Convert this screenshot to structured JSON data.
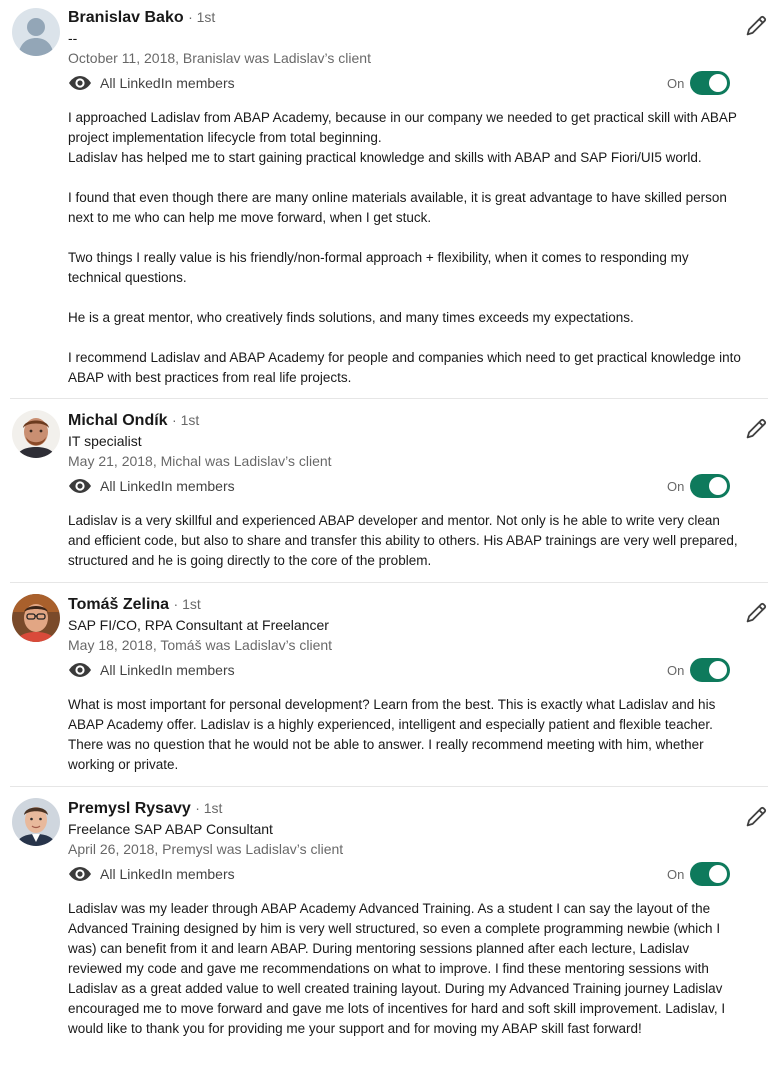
{
  "recommendations": [
    {
      "name": "Branislav Bako",
      "degree": "· 1st",
      "headline": "--",
      "date": "October 11, 2018, Branislav was Ladislav’s client",
      "visibility": "All LinkedIn members",
      "toggle_label": "On",
      "avatar": "default-person-avatar",
      "paragraphs": [
        "I approached Ladislav from ABAP Academy, because in our company we needed to get practical skill with ABAP project implementation lifecycle from total beginning.",
        "Ladislav has helped me to start gaining practical knowledge and skills with ABAP and SAP Fiori/UI5 world.",
        "I found that even though there are many online materials available, it is great advantage to have skilled person next to me who can help me move forward, when I get stuck.",
        "Two things I really value is his friendly/non-formal approach + flexibility, when it comes to responding my technical questions.",
        "He is a great mentor, who creatively finds solutions, and many times exceeds my expectations.",
        "I recommend Ladislav and ABAP Academy for people and companies which need to get practical knowledge into ABAP with best practices from real life projects."
      ]
    },
    {
      "name": "Michal Ondík",
      "degree": "· 1st",
      "headline": "IT specialist",
      "date": "May 21, 2018, Michal was Ladislav’s client",
      "visibility": "All LinkedIn members",
      "toggle_label": "On",
      "avatar": "photo-avatar",
      "paragraphs": [
        "Ladislav is a very skillful and experienced ABAP developer and mentor. Not only is he able to write very clean and efficient code, but also to share and transfer this ability to others. His ABAP trainings are very well prepared, structured and he is going directly to the core of the problem."
      ]
    },
    {
      "name": "Tomáš Zelina",
      "degree": "· 1st",
      "headline": "SAP FI/CO, RPA Consultant at Freelancer",
      "date": "May 18, 2018, Tomáš was Ladislav’s client",
      "visibility": "All LinkedIn members",
      "toggle_label": "On",
      "avatar": "photo-avatar",
      "paragraphs": [
        "What is most important for personal development? Learn from the best. This is exactly what Ladislav and his ABAP Academy offer. Ladislav is a highly experienced, intelligent and especially patient and flexible teacher. There was no question that he would not be able to answer. I really recommend meeting with him, whether working or private."
      ]
    },
    {
      "name": "Premysl Rysavy",
      "degree": "· 1st",
      "headline": "Freelance SAP ABAP Consultant",
      "date": "April 26, 2018, Premysl was Ladislav’s client",
      "visibility": "All LinkedIn members",
      "toggle_label": "On",
      "avatar": "photo-avatar",
      "paragraphs": [
        "Ladislav was my leader through ABAP Academy Advanced Training. As a student I can say the layout of the Advanced Training designed by him is very well structured, so even a complete programming newbie (which I was) can benefit from it and learn ABAP. During mentoring sessions planned after each lecture, Ladislav reviewed my code and gave me recommendations on what to improve. I find these mentoring sessions with Ladislav as a great added value to well created training layout. During my Advanced Training journey Ladislav encouraged me to move forward and gave me lots of incentives for hard and soft skill improvement. Ladislav, I would like to thank you for providing me your support and for moving my ABAP skill fast forward!"
      ]
    }
  ],
  "colors": {
    "toggle_on": "#0e7a5c",
    "separator": "#e6e6e6"
  },
  "icons": {
    "visibility": "eye-icon",
    "edit": "pencil-icon"
  }
}
